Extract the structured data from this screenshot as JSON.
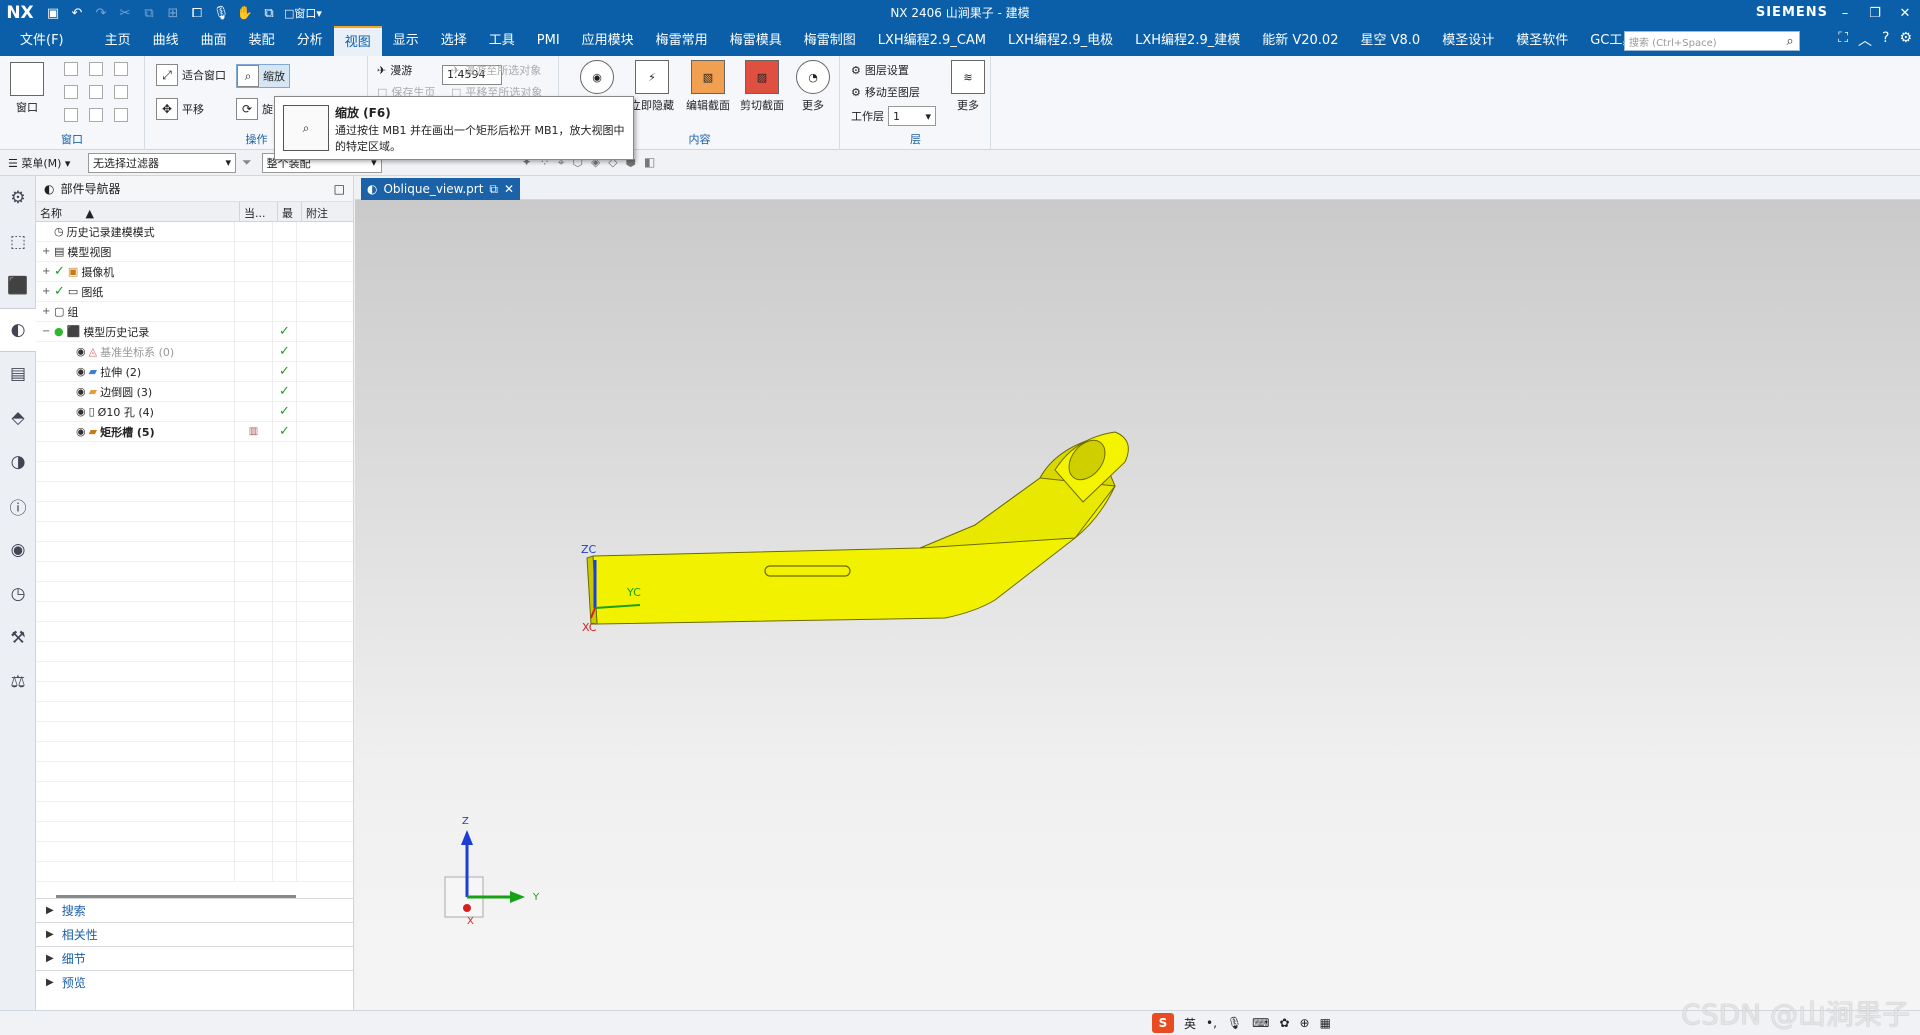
{
  "app": {
    "logo": "NX",
    "title": "NX 2406 山涧果子 - 建模",
    "brand": "SIEMENS",
    "window_label": "窗口"
  },
  "menu": [
    "文件(F)",
    "主页",
    "曲线",
    "曲面",
    "装配",
    "分析",
    "视图",
    "显示",
    "选择",
    "工具",
    "PMI",
    "应用模块",
    "梅雷常用",
    "梅雷模具",
    "梅雷制图",
    "LXH编程2.9_CAM",
    "LXH编程2.9_电极",
    "LXH编程2.9_建模",
    "能新 V20.02",
    "星空 V8.0",
    "模圣设计",
    "模圣软件",
    "GC工具箱"
  ],
  "menu_active": "视图",
  "search": {
    "placeholder": "搜索 (Ctrl+Space)"
  },
  "ribbon": {
    "window_group": {
      "label": "窗口",
      "btn": "窗口"
    },
    "ops_group": {
      "label": "操作",
      "fit": "适合窗口",
      "zoom": "缩放",
      "zoom_value": "1.4594",
      "pan": "平移",
      "rotate": "旋"
    },
    "roam": {
      "roam": "漫游",
      "roam_all": "漫游至所选对象",
      "keep": "保存生页",
      "pan_all": "平移至所选对象"
    },
    "content_group": {
      "label": "内容",
      "hide": "立即隐藏",
      "edit_section": "编辑截面",
      "clip_section": "剪切截面",
      "more": "更多"
    },
    "layer_group": {
      "label": "层",
      "layer_settings": "图层设置",
      "move_layer": "移动至图层",
      "work_layer_label": "工作层",
      "work_layer": "1",
      "more": "更多"
    }
  },
  "tooltip": {
    "title": "缩放 (F6)",
    "body": "通过按住 MB1 并在画出一个矩形后松开 MB1，放大视图中的特定区域。"
  },
  "filterbar": {
    "menu": "菜单(M)",
    "filter": "无选择过滤器",
    "assembly": "整个装配"
  },
  "navigator": {
    "title": "部件导航器",
    "columns": [
      "名称",
      "当...",
      "最",
      "附注"
    ],
    "rows": [
      {
        "name": "历史记录建模模式",
        "level": 0,
        "pm": "",
        "check": false,
        "latest": false,
        "style": ""
      },
      {
        "name": "模型视图",
        "level": 0,
        "pm": "+",
        "check": false,
        "latest": false,
        "style": ""
      },
      {
        "name": "摄像机",
        "level": 0,
        "pm": "+",
        "check": true,
        "latest": false,
        "style": ""
      },
      {
        "name": "图纸",
        "level": 0,
        "pm": "+",
        "check": true,
        "latest": false,
        "style": ""
      },
      {
        "name": "组",
        "level": 0,
        "pm": "+",
        "check": false,
        "latest": false,
        "style": ""
      },
      {
        "name": "模型历史记录",
        "level": 0,
        "pm": "−",
        "check": false,
        "latest": true,
        "style": ""
      },
      {
        "name": "基准坐标系 (0)",
        "level": 1,
        "pm": "",
        "check": false,
        "latest": true,
        "style": "grey"
      },
      {
        "name": "拉伸 (2)",
        "level": 1,
        "pm": "",
        "check": false,
        "latest": true,
        "style": ""
      },
      {
        "name": "边倒圆 (3)",
        "level": 1,
        "pm": "",
        "check": false,
        "latest": true,
        "style": ""
      },
      {
        "name": "Ø10 孔 (4)",
        "level": 1,
        "pm": "",
        "check": false,
        "latest": true,
        "style": ""
      },
      {
        "name": "矩形槽 (5)",
        "level": 1,
        "pm": "",
        "check": false,
        "latest": true,
        "style": "bold"
      }
    ],
    "sections": [
      "搜索",
      "相关性",
      "细节",
      "预览"
    ]
  },
  "tab": {
    "name": "Oblique_view.prt"
  },
  "triad": {
    "zc": "ZC",
    "yc": "YC",
    "xc": "XC",
    "z": "Z",
    "y": "Y",
    "x": "X"
  },
  "statusbar": {
    "ime": "英",
    "watermark": "CSDN @山涧果子"
  },
  "colors": {
    "accent": "#0a5fa8",
    "model": "#f2f200",
    "check": "#16a116"
  }
}
